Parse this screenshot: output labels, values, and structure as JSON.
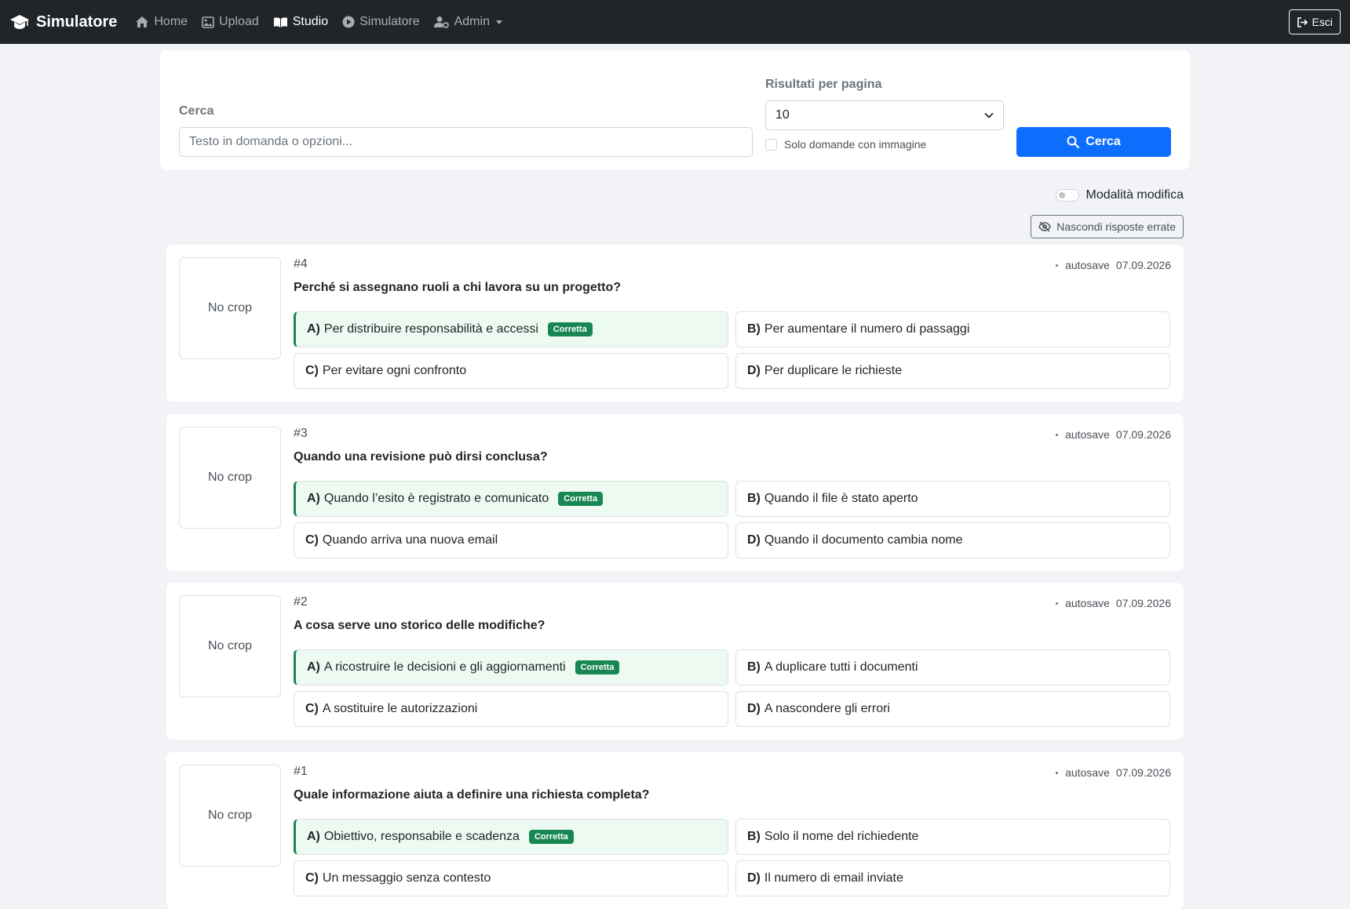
{
  "navbar": {
    "brand": "Simulatore",
    "items": [
      {
        "label": "Home",
        "icon": "home-icon",
        "active": false
      },
      {
        "label": "Upload",
        "icon": "image-icon",
        "active": false
      },
      {
        "label": "Studio",
        "icon": "book-icon",
        "active": true
      },
      {
        "label": "Simulatore",
        "icon": "play-circle-icon",
        "active": false
      },
      {
        "label": "Admin",
        "icon": "user-gear-icon",
        "active": false
      }
    ],
    "logout": "Esci"
  },
  "search": {
    "label": "Cerca",
    "placeholder": "Testo in domanda o opzioni...",
    "per_page_label": "Risultati per pagina",
    "per_page_value": "10",
    "image_only_label": "Solo domande con immagine",
    "button": "Cerca"
  },
  "toolbar": {
    "edit_mode_label": "Modalità modifica",
    "hide_wrong_label": "Nascondi risposte errate"
  },
  "questions": [
    {
      "number": "#4",
      "image": "No crop",
      "status": "autosave",
      "date": "07.09.2026",
      "text": "Perché si assegnano ruoli a chi lavora su un progetto?",
      "options": [
        {
          "letter": "A)",
          "text": "Per distribuire responsabilità e accessi",
          "correct": true
        },
        {
          "letter": "B)",
          "text": "Per aumentare il numero di passaggi",
          "correct": false
        },
        {
          "letter": "C)",
          "text": "Per evitare ogni confronto",
          "correct": false
        },
        {
          "letter": "D)",
          "text": "Per duplicare le richieste",
          "correct": false
        }
      ]
    },
    {
      "number": "#3",
      "image": "No crop",
      "status": "autosave",
      "date": "07.09.2026",
      "text": "Quando una revisione può dirsi conclusa?",
      "options": [
        {
          "letter": "A)",
          "text": "Quando l’esito è registrato e comunicato",
          "correct": true
        },
        {
          "letter": "B)",
          "text": "Quando il file è stato aperto",
          "correct": false
        },
        {
          "letter": "C)",
          "text": "Quando arriva una nuova email",
          "correct": false
        },
        {
          "letter": "D)",
          "text": "Quando il documento cambia nome",
          "correct": false
        }
      ]
    },
    {
      "number": "#2",
      "image": "No crop",
      "status": "autosave",
      "date": "07.09.2026",
      "text": "A cosa serve uno storico delle modifiche?",
      "options": [
        {
          "letter": "A)",
          "text": "A ricostruire le decisioni e gli aggiornamenti",
          "correct": true
        },
        {
          "letter": "B)",
          "text": "A duplicare tutti i documenti",
          "correct": false
        },
        {
          "letter": "C)",
          "text": "A sostituire le autorizzazioni",
          "correct": false
        },
        {
          "letter": "D)",
          "text": "A nascondere gli errori",
          "correct": false
        }
      ]
    },
    {
      "number": "#1",
      "image": "No crop",
      "status": "autosave",
      "date": "07.09.2026",
      "text": "Quale informazione aiuta a definire una richiesta completa?",
      "options": [
        {
          "letter": "A)",
          "text": "Obiettivo, responsabile e scadenza",
          "correct": true
        },
        {
          "letter": "B)",
          "text": "Solo il nome del richiedente",
          "correct": false
        },
        {
          "letter": "C)",
          "text": "Un messaggio senza contesto",
          "correct": false
        },
        {
          "letter": "D)",
          "text": "Il numero di email inviate",
          "correct": false
        }
      ]
    }
  ],
  "correct_badge": "Corretta",
  "colors": {
    "navbar": "#212529",
    "primary": "#0d6efd",
    "success": "#198754",
    "correct_bg": "#edfaf2",
    "page_bg": "#f1f3f6"
  }
}
